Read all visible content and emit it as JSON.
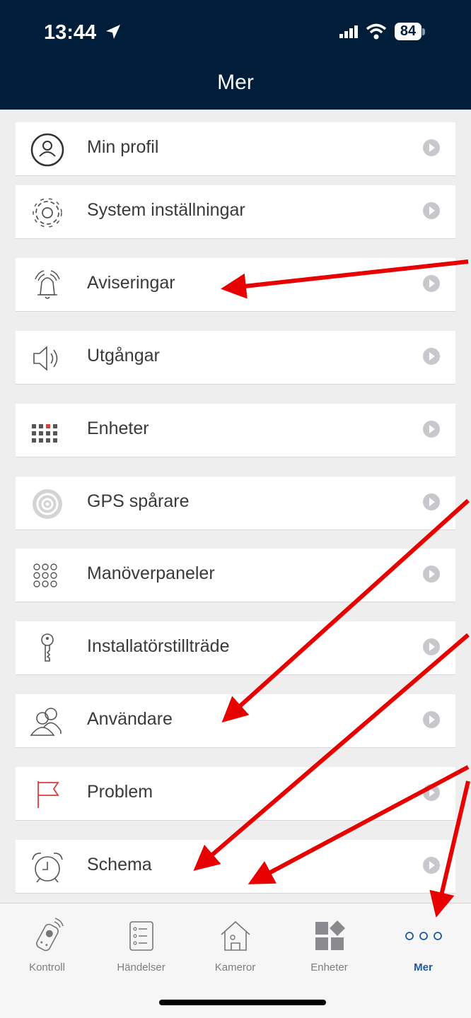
{
  "status_bar": {
    "time": "13:44",
    "battery": "84"
  },
  "header": {
    "title": "Mer"
  },
  "menu": {
    "items": [
      {
        "label": "Min profil",
        "icon": "profile-icon"
      },
      {
        "label": "System inställningar",
        "icon": "gear-icon"
      },
      {
        "label": "Aviseringar",
        "icon": "bell-icon"
      },
      {
        "label": "Utgångar",
        "icon": "speaker-icon"
      },
      {
        "label": "Enheter",
        "icon": "keypad-dots-icon"
      },
      {
        "label": "GPS spårare",
        "icon": "gps-radar-icon"
      },
      {
        "label": "Manöverpaneler",
        "icon": "panel-grid-icon"
      },
      {
        "label": "Installatörstillträde",
        "icon": "key-icon"
      },
      {
        "label": "Användare",
        "icon": "users-icon"
      },
      {
        "label": "Problem",
        "icon": "flag-icon"
      },
      {
        "label": "Schema",
        "icon": "alarm-clock-icon"
      }
    ]
  },
  "tabbar": {
    "tabs": [
      {
        "label": "Kontroll",
        "icon": "remote-icon"
      },
      {
        "label": "Händelser",
        "icon": "list-icon"
      },
      {
        "label": "Kameror",
        "icon": "house-icon"
      },
      {
        "label": "Enheter",
        "icon": "devices-icon"
      },
      {
        "label": "Mer",
        "icon": "more-dots-icon",
        "active": true
      }
    ]
  },
  "colors": {
    "header": "#001d39",
    "active_tab": "#1a5a9e",
    "annotation_arrow": "#e60000",
    "problem_flag": "#e03a3a"
  }
}
